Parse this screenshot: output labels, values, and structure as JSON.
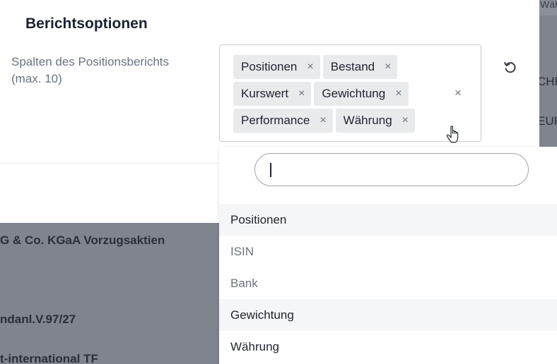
{
  "background": {
    "top_right": "Wäh",
    "right_col_1": "CHF",
    "right_col_2": "EUR",
    "row_1": "G & Co. KGaA Vorzugsaktien",
    "row_2": "ndanl.V.97/27",
    "row_3": "t-international TF"
  },
  "dialog": {
    "title": "Berichtsoptionen",
    "field_label_line1": "Spalten des Positionsberichts",
    "field_label_line2": "(max. 10)"
  },
  "selected_columns": [
    {
      "label": "Positionen"
    },
    {
      "label": "Bestand"
    },
    {
      "label": "Kurswert"
    },
    {
      "label": "Gewichtung"
    },
    {
      "label": "Performance"
    },
    {
      "label": "Währung"
    }
  ],
  "chip_remove_symbol": "×",
  "clear_all_symbol": "×",
  "dropdown": {
    "search_value": "",
    "options": [
      {
        "label": "Positionen"
      },
      {
        "label": "ISIN"
      },
      {
        "label": "Bank"
      },
      {
        "label": "Gewichtung"
      },
      {
        "label": "Währung"
      }
    ]
  },
  "icons": {
    "reset": "reset-icon",
    "cursor": "hand-cursor-icon"
  }
}
